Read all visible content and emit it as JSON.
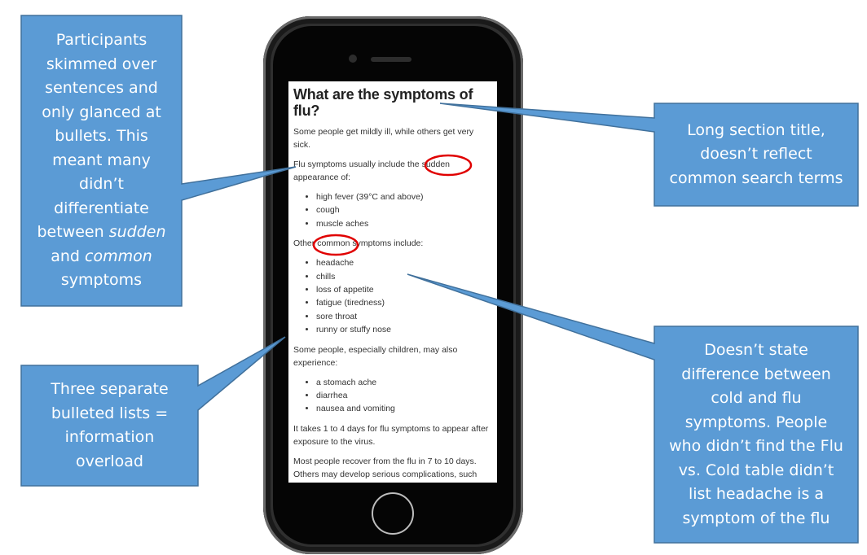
{
  "callouts": {
    "top_left": [
      "Participants",
      "skimmed over",
      "sentences and",
      "only glanced at",
      "bullets. This",
      "meant many",
      "didn’t",
      "differentiate"
    ],
    "top_left_between": "between ",
    "top_left_sudden": "sudden",
    "top_left_and": "and ",
    "top_left_common": "common",
    "top_left_last": "symptoms",
    "bottom_left": [
      "Three separate",
      "bulleted lists =",
      "information",
      "overload"
    ],
    "top_right": [
      "Long section title,",
      "doesn’t reflect",
      "common search terms"
    ],
    "bottom_right": [
      "Doesn’t state",
      "difference between",
      "cold and flu",
      "symptoms. People",
      "who didn’t find the Flu",
      "vs. Cold table didn’t",
      "list headache is a",
      "symptom of the flu"
    ]
  },
  "screen": {
    "heading": "What are the symptoms of flu?",
    "intro": "Some people get mildly ill, while others get very sick.",
    "p2_before": "Flu symptoms usually include the ",
    "p2_highlight": "sudden",
    "p2_after": " appearance of:",
    "list1": [
      "high fever (39°C and above)",
      "cough",
      "muscle aches"
    ],
    "p3_before": "Other ",
    "p3_highlight": "common",
    "p3_after": " symptoms include:",
    "list2": [
      "headache",
      "chills",
      "loss of appetite",
      "fatigue (tiredness)",
      "sore throat",
      "runny or stuffy nose"
    ],
    "p4": "Some people, especially children, may also experience:",
    "list3": [
      "a stomach ache",
      "diarrhea",
      "nausea and vomiting"
    ],
    "p5": "It takes 1 to 4 days for flu symptoms to appear after exposure to the virus.",
    "p6": "Most people recover from the flu in 7 to 10 days. Others may develop serious complications, such"
  },
  "colors": {
    "callout_fill": "#5b9bd5",
    "callout_border": "#41719c",
    "highlight_circle": "#e00000"
  }
}
